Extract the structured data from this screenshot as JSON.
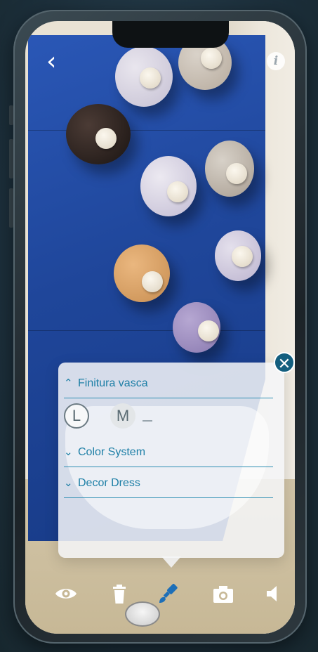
{
  "colors": {
    "accent": "#1d7fa6",
    "close_button": "#135e7e",
    "wall_blue": "#1f469a",
    "toolbar_icon": "#ffffff",
    "active_tool": "#1d6fb8"
  },
  "nav": {
    "back_icon": "chevron-left-icon",
    "back_glyph": "‹",
    "info_icon": "info-icon",
    "info_glyph": "i"
  },
  "panel": {
    "close_glyph": "✕",
    "sections": [
      {
        "label": "Finitura vasca",
        "chevron": "⌃",
        "state": "expanded"
      },
      {
        "label": "Color System",
        "chevron": "⌄",
        "state": "collapsed"
      },
      {
        "label": "Decor Dress",
        "chevron": "⌄",
        "state": "collapsed"
      }
    ],
    "sizes": [
      {
        "label": "L",
        "selected": true
      },
      {
        "label": "M",
        "selected": false
      }
    ]
  },
  "toolbar": {
    "items": [
      {
        "icon": "eye-icon"
      },
      {
        "icon": "trash-icon"
      },
      {
        "icon": "paint-brush-icon",
        "active": true
      },
      {
        "icon": "camera-icon"
      },
      {
        "icon": "speaker-icon"
      }
    ]
  }
}
